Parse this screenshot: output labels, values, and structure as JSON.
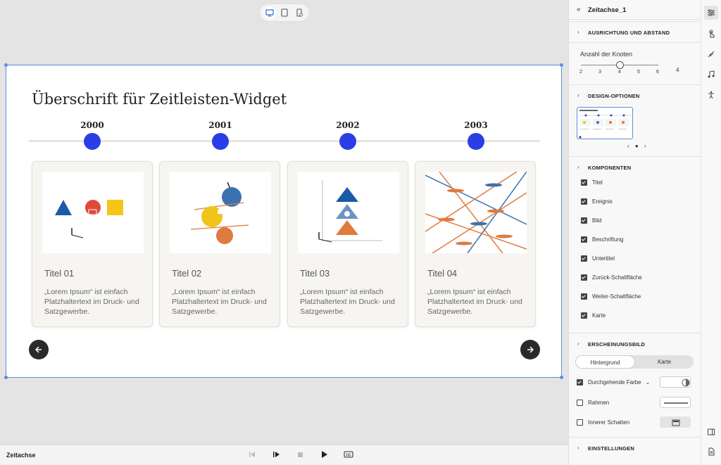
{
  "widget": {
    "title": "Überschrift für Zeitleisten-Widget",
    "node_color": "#2b3ee6",
    "years": [
      "2000",
      "2001",
      "2002",
      "2003"
    ],
    "cards": [
      {
        "title": "Titel 01",
        "desc": "„Lorem Ipsum“ ist einfach Platzhaltertext im Druck- und Satzgewerbe.",
        "image": "shapes-illustration"
      },
      {
        "title": "Titel 02",
        "desc": "„Lorem Ipsum“ ist einfach Platzhaltertext im Druck- und Satzgewerbe.",
        "image": "balancing-spheres-illustration"
      },
      {
        "title": "Titel 03",
        "desc": "„Lorem Ipsum“ ist einfach Platzhaltertext im Druck- und Satzgewerbe.",
        "image": "stacked-triangles-illustration"
      },
      {
        "title": "Titel 04",
        "desc": "„Lorem Ipsum“ ist einfach Platzhaltertext im Druck- und Satzgewerbe.",
        "image": "crossing-lines-illustration"
      }
    ],
    "prev_icon": "arrow-left-icon",
    "next_icon": "arrow-right-icon"
  },
  "bottom_bar": {
    "label": "Zeitachse",
    "controls": [
      "step-back-icon",
      "step-forward-icon",
      "stop-icon",
      "play-icon",
      "cc-icon"
    ]
  },
  "panel": {
    "back_icon": "double-chevron-left-icon",
    "name": "Zeitachse_1",
    "sections": {
      "alignment": "AUSRICHTUNG UND ABSTAND",
      "design": "DESIGN-OPTIONEN",
      "components": "KOMPONENTEN",
      "appearance": "ERSCHEINUNGSBILD",
      "settings": "EINSTELLUNGEN"
    },
    "node_count": {
      "label": "Anzahl der Knoten",
      "ticks": [
        "2",
        "3",
        "4",
        "5",
        "6"
      ],
      "value": "4",
      "fraction": 0.5
    },
    "components": [
      {
        "label": "Titel",
        "checked": true
      },
      {
        "label": "Ereignis",
        "checked": true
      },
      {
        "label": "Bild",
        "checked": true
      },
      {
        "label": "Beschriftung",
        "checked": true
      },
      {
        "label": "Untertitel",
        "checked": true
      },
      {
        "label": "Zurück-Schaltfläche",
        "checked": true
      },
      {
        "label": "Weiter-Schaltfläche",
        "checked": true
      },
      {
        "label": "Karte",
        "checked": true
      }
    ],
    "appearance": {
      "tabs": [
        "Hintergrund",
        "Karte"
      ],
      "active_tab": "Hintergrund",
      "solid_color": "Durchgehende Farbe",
      "border": "Rahmen",
      "inner_shadow": "Innerer Schatten"
    }
  },
  "rail_icons": [
    "properties-icon",
    "interaction-icon",
    "effects-icon",
    "audio-icon",
    "accessibility-icon",
    "panel-toggle-icon",
    "document-icon"
  ]
}
